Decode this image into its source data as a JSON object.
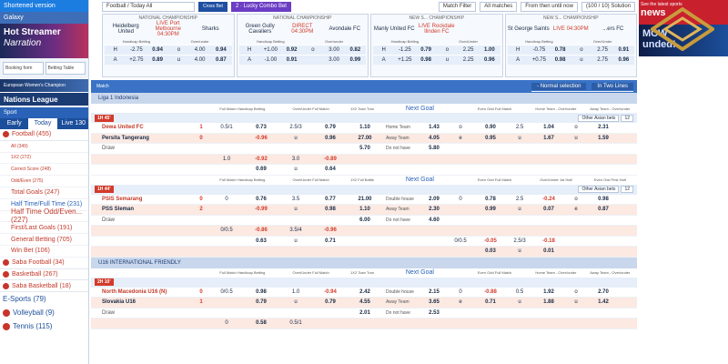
{
  "sidebar": {
    "shortened": "Shortened version",
    "galaxy": "Galaxy",
    "banner_l1": "Hot Streamer",
    "banner_l2": "Narration",
    "booking": "Booking form",
    "betting_table": "Betting Table",
    "euro_banner": "European Women's Champion",
    "nations": "Nations League",
    "sport": "Sport",
    "tab_early": "Early",
    "tab_today": "Today",
    "tab_live": "Live 130",
    "items": [
      {
        "label": "Football (455)",
        "type": "sport"
      },
      {
        "label": "All (349)",
        "type": "small"
      },
      {
        "label": "1X2 (272)",
        "type": "small"
      },
      {
        "label": "Correct Score (248)",
        "type": "small"
      },
      {
        "label": "Odd/Even (275)",
        "type": "small"
      },
      {
        "label": "Total Goals (247)",
        "type": "normal"
      },
      {
        "label": "Half Time/Full Time (231)",
        "type": "blue"
      },
      {
        "label": "Half Time Odd/Even... (227)",
        "type": "large"
      },
      {
        "label": "First/Last Goals (191)",
        "type": "normal"
      },
      {
        "label": "General Betting (705)",
        "type": "normal"
      },
      {
        "label": "Win Bet (106)",
        "type": "normal"
      },
      {
        "label": "Saba Football (34)",
        "type": "sport"
      },
      {
        "label": "Basketball (267)",
        "type": "sport"
      },
      {
        "label": "Saba Basketball (18)",
        "type": "sport"
      }
    ],
    "esports": "E-Sports (79)",
    "volleyball": "Volleyball (9)",
    "tennis": "Tennis (115)"
  },
  "top": {
    "football_select": "Football / Today All",
    "cross_bet": "Cross Bet",
    "lucky": "2 · Lucky Combo Bet",
    "match_filter": "Match Filter",
    "all_matches": "All matches",
    "from_then": "From then until now",
    "solution": "(100 / 10) Solution"
  },
  "cards": [
    {
      "league": "NATIONAL CHAMPIONSHIP",
      "home": "Heidelberg United",
      "live": "LIVE Port Melbourne 04:30PM",
      "away": "Sharks",
      "h1": "Handicap Betting",
      "h2": "Over/under",
      "r1": [
        "H",
        "-2.75",
        "0.94",
        "o",
        "4.00",
        "0.94"
      ],
      "r2": [
        "A",
        "+2.75",
        "0.89",
        "u",
        "4.00",
        "0.87"
      ]
    },
    {
      "league": "NATIONAL CHAMPIONSHIP",
      "home": "Green Gully Cavaliers",
      "live": "DIRECT 04:30PM",
      "away": "Avondale FC",
      "h1": "Handicap Betting",
      "h2": "Over/under",
      "r1": [
        "H",
        "+1.00",
        "0.92",
        "o",
        "3.00",
        "0.82"
      ],
      "r2": [
        "A",
        "-1.00",
        "0.91",
        "",
        "3.00",
        "0.99"
      ]
    },
    {
      "league": "NEW S... CHAMPIONSHIP",
      "home": "Manly United FC",
      "live": "LIVE Rockdale Ilinden FC",
      "away": "",
      "h1": "Handicap Betting",
      "h2": "Over/Under",
      "r1": [
        "H",
        "-1.25",
        "0.79",
        "o",
        "2.25",
        "1.00"
      ],
      "r2": [
        "A",
        "+1.25",
        "0.98",
        "u",
        "2.25",
        "0.96"
      ]
    },
    {
      "league": "NEW S... CHAMPIONSHIP",
      "home": "St George Saints",
      "live": "LIVE 04:30PM",
      "away": "...ers FC",
      "h1": "Handicap Betting",
      "h2": "Over/Under",
      "r1": [
        "H",
        "-0.75",
        "0.78",
        "o",
        "2.75",
        "0.91"
      ],
      "r2": [
        "A",
        "+0.75",
        "0.98",
        "u",
        "2.75",
        "0.96"
      ]
    }
  ],
  "right_banner": {
    "small": "See the latest sports",
    "news": "news",
    "brand": "MCW",
    "sub": "unded!"
  },
  "table": {
    "match": "Match",
    "normal": "- Normal selection",
    "two_lines": "In Two Lines",
    "league1": "Liga 1 Indonesia",
    "league2": "U16 INTERNATIONAL FRIENDLY",
    "colh": [
      "Full Match Handicap Betting",
      "Over/Under Full Match",
      "1X2 Toan Tran",
      "Next Goal",
      "Even Odd Full Match",
      "Home Team - Over/under",
      "Away Team - Over/under"
    ],
    "colh2": [
      "Full Match Handicap Betting",
      "Over/Under Full Match",
      "1X2 Full Battle",
      "Next Goal",
      "Even Odd Full Match",
      "Over/Under 1st Half",
      "Even Odd First Half"
    ],
    "colh3": [
      "Full Match Handicap Betting",
      "Over/Under Full Match",
      "1X2 Toan Tran",
      "Next Goal",
      "Even Odd Full Match",
      "Home Team - Over/under",
      "Away Team - Over/under"
    ],
    "m1": {
      "time": "1H 45'",
      "home": "Dewa United FC",
      "away": "Persita Tangerang",
      "draw": "Draw",
      "hs": "1",
      "as": "0",
      "rows": [
        [
          "0.5/1",
          "0.73",
          "2.5/3",
          "0.79",
          "1.10",
          "Home Team",
          "1.43",
          "o",
          "0.90",
          "2.5",
          "1.04",
          "o",
          "2.31"
        ],
        [
          "",
          "-0.96",
          "u",
          "0.96",
          "27.00",
          "Away Team",
          "4.05",
          "e",
          "0.95",
          "u",
          "1.67",
          "u",
          "1.59"
        ],
        [
          "",
          "",
          "",
          "",
          "5.70",
          "Do not have",
          "5.80",
          "",
          "",
          "",
          "",
          "",
          ""
        ],
        [
          "1.0",
          "-0.92",
          "3.0",
          "-0.89",
          "",
          "",
          "",
          "",
          "",
          "",
          "",
          "",
          ""
        ],
        [
          "",
          "0.69",
          "u",
          "0.64",
          "",
          "",
          "",
          "",
          "",
          "",
          "",
          "",
          ""
        ]
      ],
      "other": "Other Asian bets",
      "count": "12"
    },
    "m2": {
      "time": "1H 44'",
      "home": "PSIS Semarang",
      "away": "PSS Sleman",
      "draw": "Draw",
      "hs": "0",
      "as": "2",
      "rows": [
        [
          "0",
          "0.76",
          "3.5",
          "0.77",
          "21.00",
          "Double house",
          "2.09",
          "0",
          "0.78",
          "2.5",
          "-0.24",
          "o",
          "0.98"
        ],
        [
          "",
          "-0.99",
          "u",
          "0.98",
          "1.10",
          "Away Team",
          "2.30",
          "",
          "0.99",
          "u",
          "0.07",
          "e",
          "0.87"
        ],
        [
          "",
          "",
          "",
          "",
          "6.00",
          "Do not have",
          "4.60",
          "",
          "",
          "",
          "",
          "",
          ""
        ],
        [
          "0/0.5",
          "-0.86",
          "3.5/4",
          "-0.96",
          "",
          "",
          "",
          "",
          "",
          "",
          "",
          "",
          ""
        ],
        [
          "",
          "0.63",
          "u",
          "0.71",
          "",
          "",
          "",
          "0/0.5",
          "-0.05",
          "2.5/3",
          "-0.18",
          "",
          ""
        ],
        [
          "",
          "",
          "",
          "",
          "",
          "",
          "",
          "",
          "0.03",
          "u",
          "0.01",
          "",
          ""
        ]
      ],
      "other": "Other Asian bets",
      "count": "12"
    },
    "m3": {
      "time": "2H 10'",
      "home": "North Macedonia U16 (N)",
      "away": "Slovakia U16",
      "draw": "Draw",
      "hs": "0",
      "as": "1",
      "rows": [
        [
          "0/0.5",
          "0.98",
          "1.0",
          "-0.94",
          "2.42",
          "Double house",
          "2.15",
          "0",
          "-0.88",
          "0.5",
          "1.92",
          "o",
          "2.70"
        ],
        [
          "",
          "0.79",
          "u",
          "0.79",
          "4.55",
          "Away Team",
          "3.65",
          "e",
          "0.71",
          "u",
          "1.88",
          "u",
          "1.42"
        ],
        [
          "",
          "",
          "",
          "",
          "2.01",
          "Do not have",
          "2.53",
          "",
          "",
          "",
          "",
          "",
          ""
        ],
        [
          "0",
          "0.58",
          "0.5/1",
          "",
          "",
          "",
          "",
          "",
          "",
          "",
          "",
          "",
          ""
        ]
      ]
    }
  }
}
